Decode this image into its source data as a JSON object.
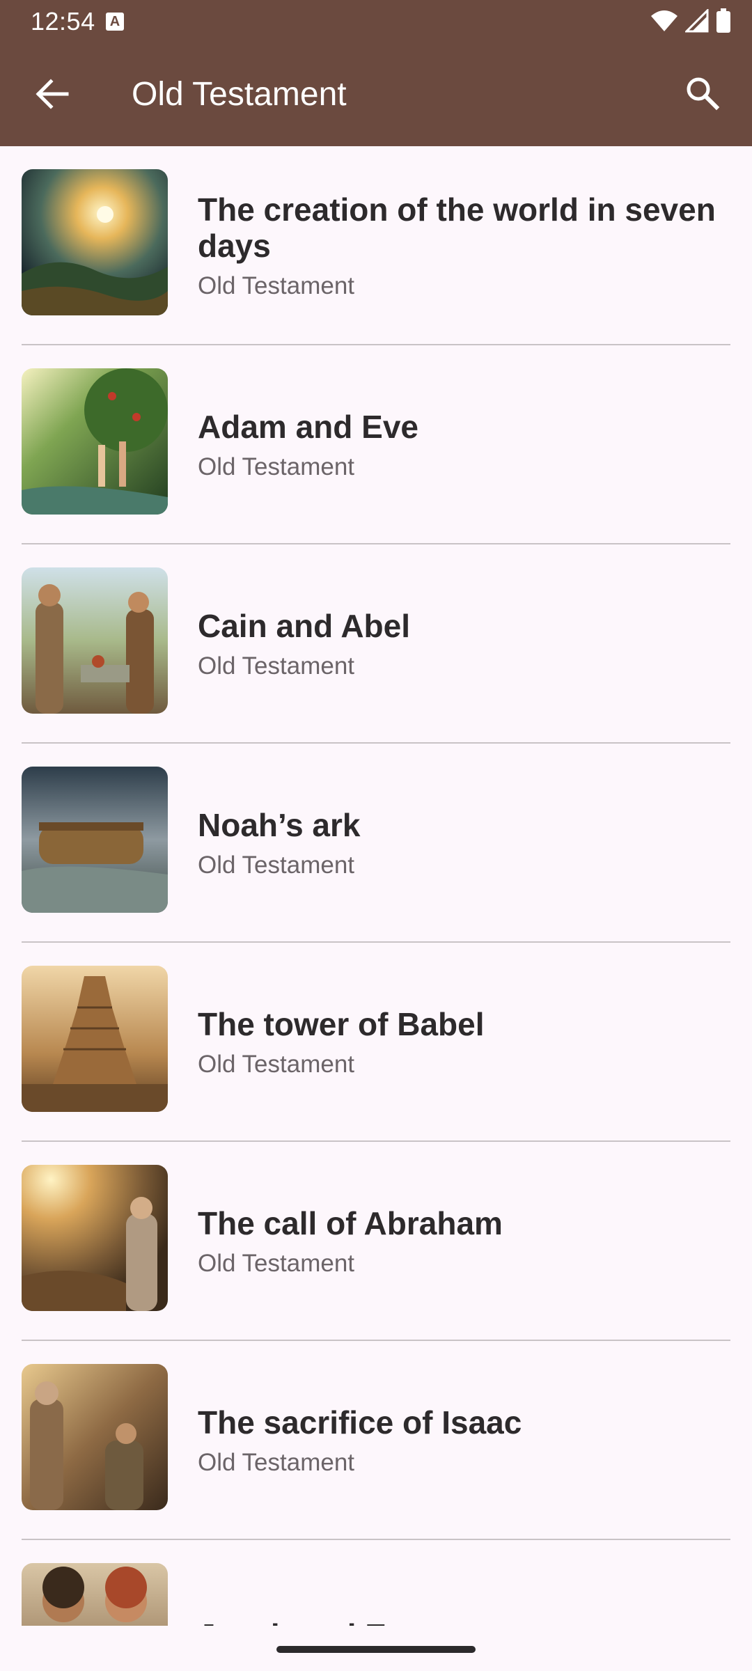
{
  "status_bar": {
    "time": "12:54",
    "notification_icon": "a-icon",
    "icons": [
      "wifi-icon",
      "signal-icon",
      "battery-icon"
    ]
  },
  "toolbar": {
    "title": "Old Testament",
    "back_icon": "arrow-back-icon",
    "search_icon": "search-icon"
  },
  "colors": {
    "appbar": "#6b4a3f",
    "background": "#fdf7fc",
    "title_text": "#2d2a2c",
    "subtitle_text": "#6b6468",
    "divider": "#c9c3c6"
  },
  "stories": [
    {
      "title": "The creation of the world in seven days",
      "subtitle": "Old Testament"
    },
    {
      "title": "Adam and Eve",
      "subtitle": "Old Testament"
    },
    {
      "title": "Cain and Abel",
      "subtitle": "Old Testament"
    },
    {
      "title": "Noah’s ark",
      "subtitle": "Old Testament"
    },
    {
      "title": "The tower of Babel",
      "subtitle": "Old Testament"
    },
    {
      "title": "The call of Abraham",
      "subtitle": "Old Testament"
    },
    {
      "title": "The sacrifice of Isaac",
      "subtitle": "Old Testament"
    },
    {
      "title": "Jacob and Esau",
      "subtitle": ""
    }
  ]
}
